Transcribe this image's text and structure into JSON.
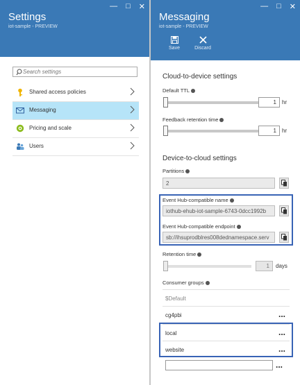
{
  "left_blade": {
    "title": "Settings",
    "subtitle": "iot-sample - PREVIEW",
    "search_placeholder": "Search settings",
    "menu": [
      {
        "label": "Shared access policies"
      },
      {
        "label": "Messaging"
      },
      {
        "label": "Pricing and scale"
      },
      {
        "label": "Users"
      }
    ]
  },
  "right_blade": {
    "title": "Messaging",
    "subtitle": "iot-sample - PREVIEW",
    "commands": {
      "save": "Save",
      "discard": "Discard"
    },
    "c2d_section": "Cloud-to-device settings",
    "default_ttl": {
      "label": "Default TTL",
      "value": "1",
      "unit": "hr"
    },
    "feedback_retention": {
      "label": "Feedback retention time",
      "value": "1",
      "unit": "hr"
    },
    "d2c_section": "Device-to-cloud settings",
    "partitions": {
      "label": "Partitions",
      "value": "2"
    },
    "event_hub_name": {
      "label": "Event Hub-compatible name",
      "value": "iothub-ehub-iot-sample-6743-0dcc1992b"
    },
    "event_hub_endpoint": {
      "label": "Event Hub-compatible endpoint",
      "value": "sb://ihsuprodblres008dednamespace.serv"
    },
    "retention_time": {
      "label": "Retention time",
      "value": "1",
      "unit": "days"
    },
    "consumer_groups": {
      "label": "Consumer groups",
      "items": [
        "$Default",
        "cg4pbi",
        "local",
        "website"
      ],
      "more": "..."
    }
  },
  "colors": {
    "header": "#3a79b6",
    "active_item": "#b6e4f8",
    "highlight_border": "#3863b5"
  }
}
